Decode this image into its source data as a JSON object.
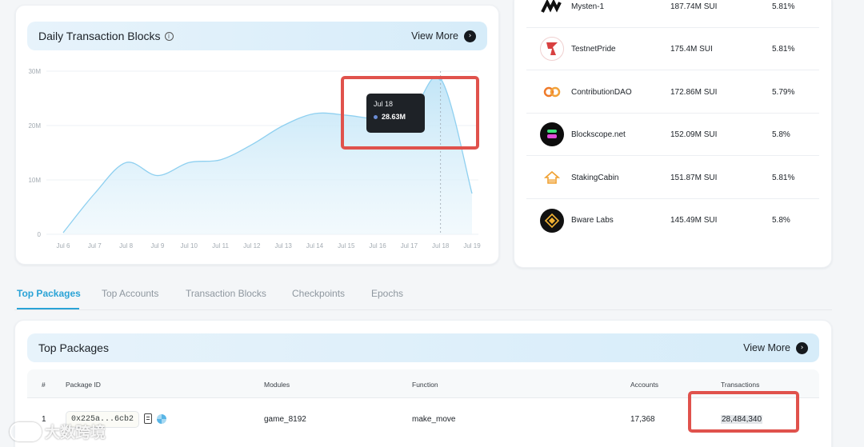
{
  "chart_card": {
    "title": "Daily Transaction Blocks",
    "info_icon": "info-icon",
    "view_more": "View More"
  },
  "chart_data": {
    "type": "area",
    "title": "Daily Transaction Blocks",
    "x_ticks": [
      "Jul 6",
      "Jul 7",
      "Jul 8",
      "Jul 9",
      "Jul 10",
      "Jul 11",
      "Jul 12",
      "Jul 13",
      "Jul 14",
      "Jul 15",
      "Jul 16",
      "Jul 17",
      "Jul 18",
      "Jul 19"
    ],
    "y_ticks": [
      "0",
      "10M",
      "20M",
      "30M"
    ],
    "ylim": [
      0,
      30000000
    ],
    "series": [
      {
        "points": [
          [
            "Jul 6",
            0.3
          ],
          [
            "Jul 7",
            7.5
          ],
          [
            "Jul 8",
            13.2
          ],
          [
            "Jul 9",
            10.8
          ],
          [
            "Jul 10",
            13.2
          ],
          [
            "Jul 11",
            13.7
          ],
          [
            "Jul 12",
            16.5
          ],
          [
            "Jul 13",
            20.0
          ],
          [
            "Jul 14",
            22.2
          ],
          [
            "Jul 15",
            21.9
          ],
          [
            "Jul 16",
            21.2
          ],
          [
            "Jul 17",
            21.5
          ],
          [
            "Jul 18",
            28.63
          ],
          [
            "Jul 19",
            7.5
          ]
        ],
        "unit": "M",
        "color": "#8fd0f0"
      }
    ],
    "grid": true,
    "tooltip": {
      "label": "Jul 18",
      "value": "28.63M"
    }
  },
  "validators": [
    {
      "name": "Mysten-1",
      "stake": "187.74M SUI",
      "apy": "5.81%",
      "icon": "mysten-logo-icon"
    },
    {
      "name": "TestnetPride",
      "stake": "175.4M SUI",
      "apy": "5.81%",
      "icon": "pride-logo-icon"
    },
    {
      "name": "ContributionDAO",
      "stake": "172.86M SUI",
      "apy": "5.79%",
      "icon": "contributiondao-logo-icon"
    },
    {
      "name": "Blockscope.net",
      "stake": "152.09M SUI",
      "apy": "5.8%",
      "icon": "blockscope-logo-icon"
    },
    {
      "name": "StakingCabin",
      "stake": "151.87M SUI",
      "apy": "5.81%",
      "icon": "stakingcabin-logo-icon"
    },
    {
      "name": "Bware Labs",
      "stake": "145.49M SUI",
      "apy": "5.8%",
      "icon": "bware-logo-icon"
    }
  ],
  "tabs": [
    "Top Packages",
    "Top Accounts",
    "Transaction Blocks",
    "Checkpoints",
    "Epochs"
  ],
  "packages_card": {
    "title": "Top Packages",
    "view_more": "View More",
    "columns": [
      "#",
      "Package ID",
      "Modules",
      "Function",
      "Accounts",
      "Transactions"
    ],
    "rows": [
      {
        "rank": "1",
        "package_id": "0x225a...6cb2",
        "module": "game_8192",
        "function": "make_move",
        "accounts": "17,368",
        "transactions": "28,484,340"
      }
    ]
  },
  "watermark": {
    "text": "大数跨境"
  },
  "colors": {
    "accent": "#2aa3d6",
    "highlight": "#e0524c",
    "area": "#8fd0f0"
  }
}
